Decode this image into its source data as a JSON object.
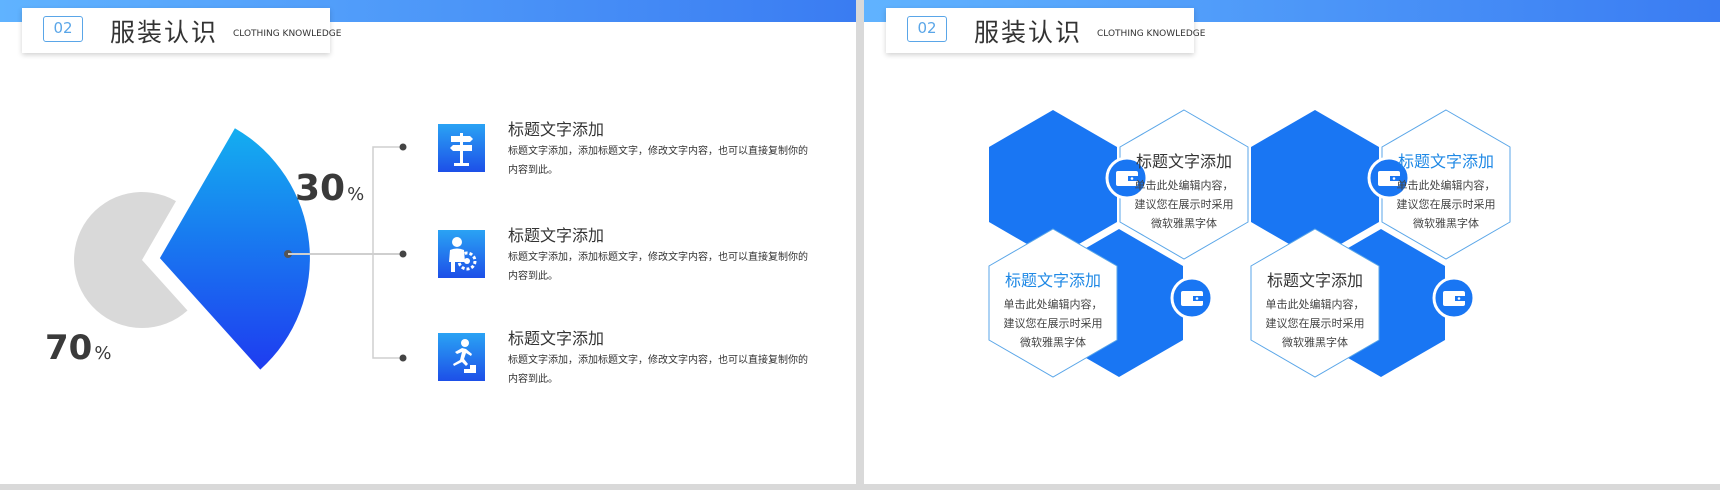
{
  "colors": {
    "accent": "#1976f3",
    "text": "#333333",
    "grey_slice": "#d9d9d9",
    "header_accent": "#5aa6e8"
  },
  "slides": [
    {
      "header": {
        "number": "02",
        "title": "服装认识",
        "subtitle": "CLOTHING KNOWLEDGE"
      },
      "chart_data": {
        "type": "pie",
        "values": [
          30,
          70
        ],
        "percent_labels": [
          {
            "value": "30",
            "unit": "%"
          },
          {
            "value": "70",
            "unit": "%"
          }
        ]
      },
      "items": [
        {
          "icon": "signpost-icon",
          "title": "标题文字添加",
          "desc": "标题文字添加，添加标题文字，修改文字内容，也可以直接复制你的内容到此。"
        },
        {
          "icon": "businessman-gear-icon",
          "title": "标题文字添加",
          "desc": "标题文字添加，添加标题文字，修改文字内容，也可以直接复制你的内容到此。"
        },
        {
          "icon": "running-person-stairs-icon",
          "title": "标题文字添加",
          "desc": "标题文字添加，添加标题文字，修改文字内容，也可以直接复制你的内容到此。"
        }
      ]
    },
    {
      "header": {
        "number": "02",
        "title": "服装认识",
        "subtitle": "CLOTHING KNOWLEDGE"
      },
      "hexes": [
        {
          "title": "标题文字添加",
          "body": [
            "单击此处编辑内容，",
            "建议您在展示时采用",
            "微软雅黑字体"
          ]
        },
        {
          "title": "标题文字添加",
          "body": [
            "单击此处编辑内容，",
            "建议您在展示时采用",
            "微软雅黑字体"
          ]
        },
        {
          "title": "标题文字添加",
          "body": [
            "单击此处编辑内容，",
            "建议您在展示时采用",
            "微软雅黑字体"
          ]
        },
        {
          "title": "标题文字添加",
          "body": [
            "单击此处编辑内容，",
            "建议您在展示时采用",
            "微软雅黑字体"
          ]
        }
      ],
      "hex_icon": "wallet-icon"
    }
  ]
}
